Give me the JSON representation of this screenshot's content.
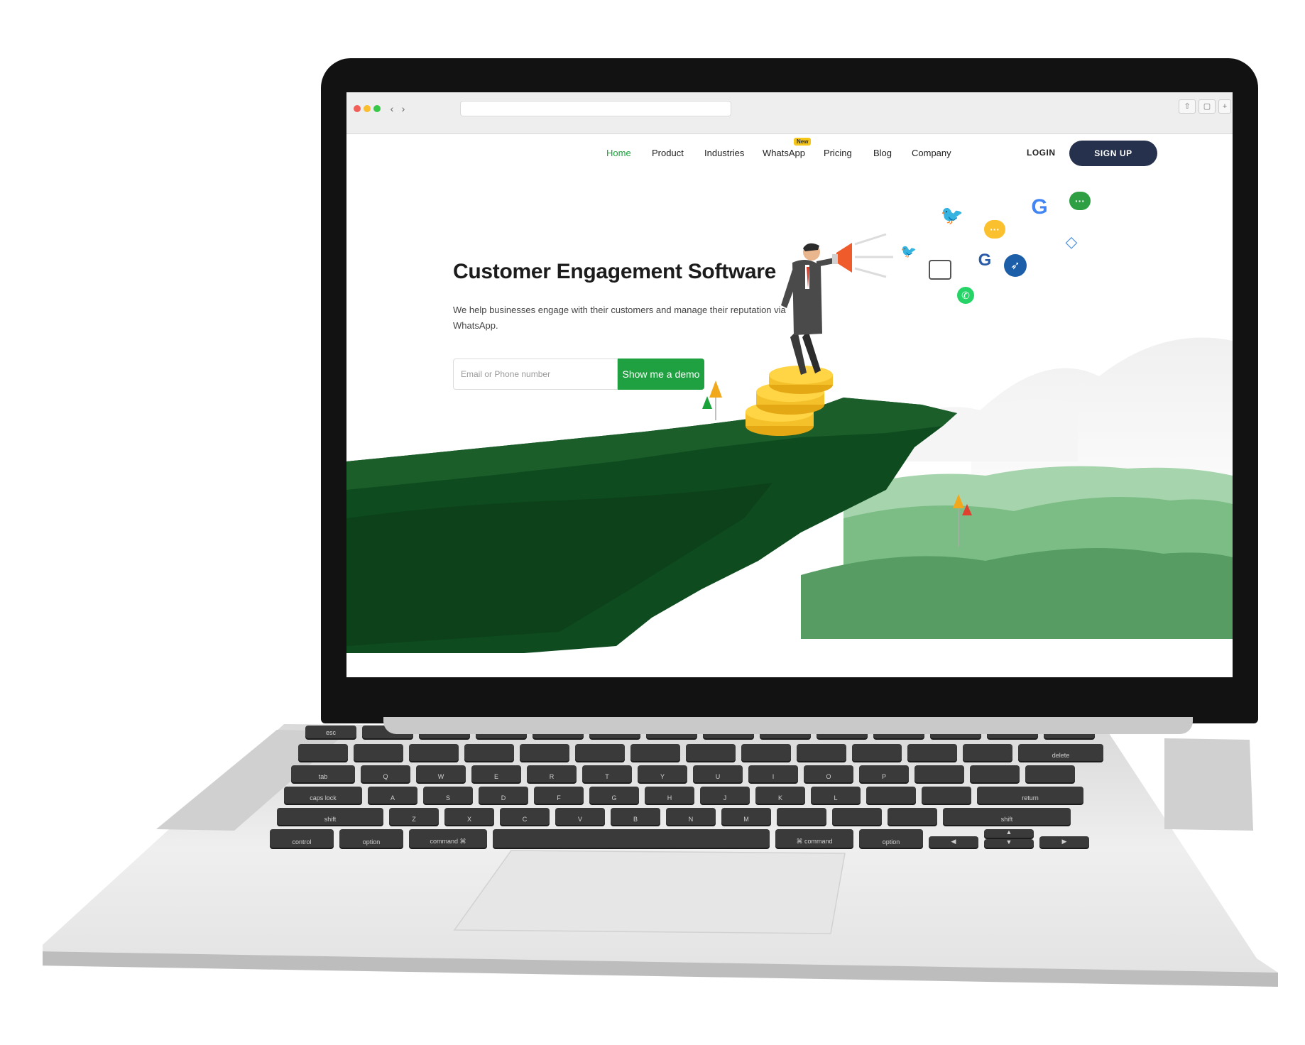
{
  "browser": {
    "traffic_lights": {
      "close": "#f25f58",
      "minimize": "#fbbe2e",
      "maximize": "#37c84a"
    }
  },
  "nav": {
    "links": [
      "Home",
      "Product",
      "Industries",
      "WhatsApp",
      "Pricing",
      "Blog",
      "Company"
    ],
    "badge": "New",
    "login": "LOGIN",
    "signup": "SIGN UP"
  },
  "hero": {
    "title": "Customer Engagement Software",
    "subtitle": "We help businesses engage with their customers and manage their reputation via WhatsApp.",
    "input_placeholder": "Email or Phone number",
    "cta": "Show me a demo"
  },
  "keyboard": {
    "labels": {
      "esc": "esc",
      "tab": "tab",
      "caps": "caps lock",
      "shift_l": "shift",
      "shift_r": "shift",
      "control": "control",
      "option_l": "option",
      "command_l": "command ⌘",
      "command_r": "⌘ command",
      "option_r": "option",
      "delete": "delete",
      "return": "return"
    },
    "rows": [
      [
        "Q",
        "W",
        "E",
        "R",
        "T",
        "Y",
        "U",
        "I",
        "O",
        "P"
      ],
      [
        "A",
        "S",
        "D",
        "F",
        "G",
        "H",
        "J",
        "K",
        "L"
      ],
      [
        "Z",
        "X",
        "C",
        "V",
        "B",
        "N",
        "M"
      ]
    ]
  },
  "colors": {
    "brand_green": "#1fa141",
    "navy": "#25314d",
    "cliff_dark": "#0f4a1f",
    "cliff_top": "#1b5e2a"
  },
  "social_icons": [
    "twitter-icon",
    "google-icon",
    "chat-icon",
    "whatsapp-icon",
    "g2-icon",
    "message-icon"
  ]
}
